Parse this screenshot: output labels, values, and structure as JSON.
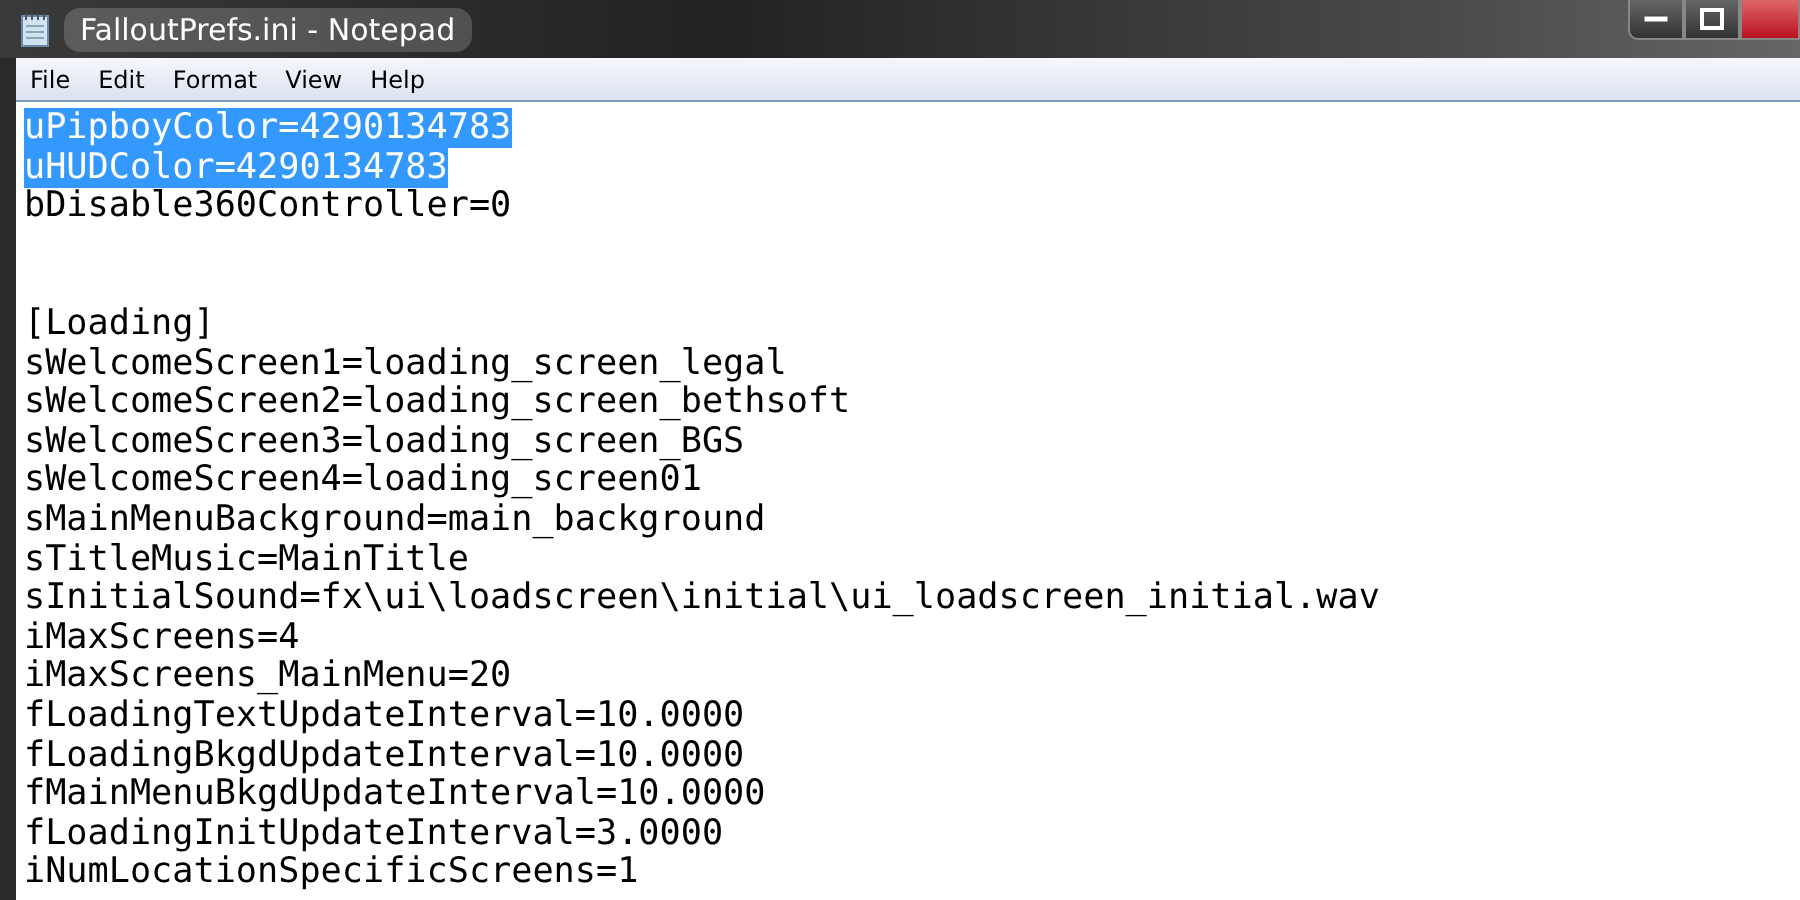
{
  "window": {
    "title": "FalloutPrefs.ini - Notepad",
    "buttons": [
      {
        "kind": "minimize"
      },
      {
        "kind": "maximize"
      },
      {
        "kind": "close"
      }
    ]
  },
  "menu": [
    "File",
    "Edit",
    "Format",
    "View",
    "Help"
  ],
  "editor": {
    "lines": [
      {
        "kind": "text",
        "text": "uPipboyColor=4290134783",
        "selected": true
      },
      {
        "kind": "text",
        "text": "uHUDColor=4290134783",
        "selected": true
      },
      {
        "kind": "text",
        "text": "bDisable360Controller=0",
        "selected": false
      },
      {
        "kind": "blank"
      },
      {
        "kind": "blank"
      },
      {
        "kind": "text",
        "text": "[Loading]",
        "selected": false
      },
      {
        "kind": "text",
        "text": "sWelcomeScreen1=loading_screen_legal",
        "selected": false
      },
      {
        "kind": "text",
        "text": "sWelcomeScreen2=loading_screen_bethsoft",
        "selected": false
      },
      {
        "kind": "text",
        "text": "sWelcomeScreen3=loading_screen_BGS",
        "selected": false
      },
      {
        "kind": "text",
        "text": "sWelcomeScreen4=loading_screen01",
        "selected": false
      },
      {
        "kind": "text",
        "text": "sMainMenuBackground=main_background",
        "selected": false
      },
      {
        "kind": "text",
        "text": "sTitleMusic=MainTitle",
        "selected": false
      },
      {
        "kind": "text",
        "text": "sInitialSound=fx\\ui\\loadscreen\\initial\\ui_loadscreen_initial.wav",
        "selected": false
      },
      {
        "kind": "text",
        "text": "iMaxScreens=4",
        "selected": false
      },
      {
        "kind": "text",
        "text": "iMaxScreens_MainMenu=20",
        "selected": false
      },
      {
        "kind": "text",
        "text": "fLoadingTextUpdateInterval=10.0000",
        "selected": false
      },
      {
        "kind": "text",
        "text": "fLoadingBkgdUpdateInterval=10.0000",
        "selected": false
      },
      {
        "kind": "text",
        "text": "fMainMenuBkgdUpdateInterval=10.0000",
        "selected": false
      },
      {
        "kind": "text",
        "text": "fLoadingInitUpdateInterval=3.0000",
        "selected": false
      },
      {
        "kind": "text",
        "text": "iNumLocationSpecificScreens=1",
        "selected": false
      }
    ]
  }
}
